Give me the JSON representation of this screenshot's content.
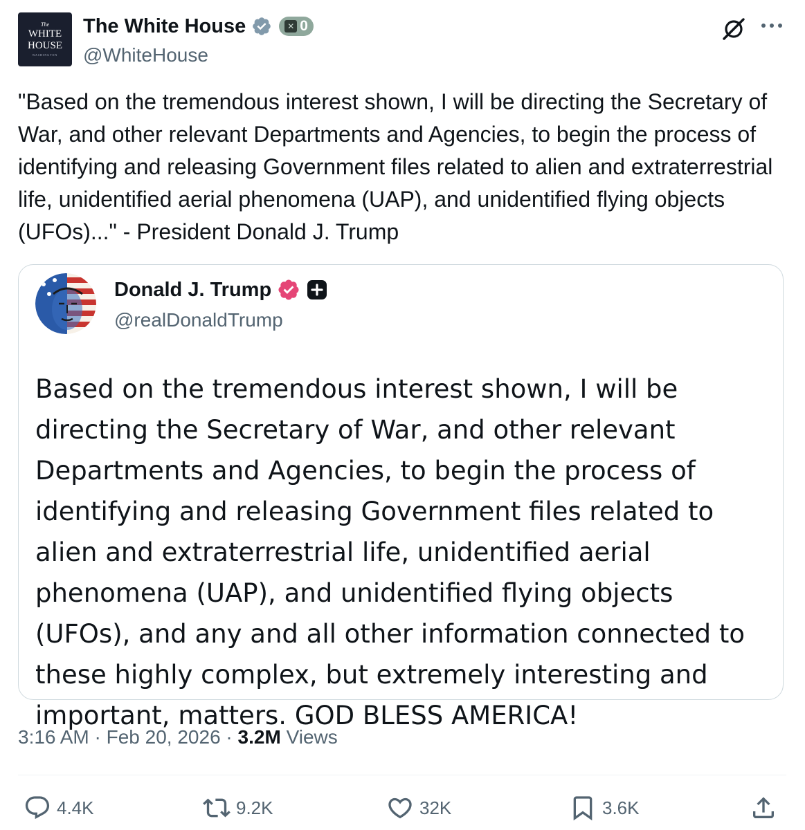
{
  "post": {
    "author": {
      "display_name": "The White House",
      "handle": "@WhiteHouse",
      "avatar_text": {
        "line0": "The",
        "line1": "WHITE",
        "line2": "HOUSE",
        "line3": "WASHINGTON"
      },
      "badge_count": "0"
    },
    "text": "\"Based on the tremendous interest shown, I will be directing the Secretary of War, and other relevant Departments and Agencies, to begin the process of identifying and releasing Government files related to alien and extraterrestrial life, unidentified aerial phenomena (UAP), and unidentified flying objects (UFOs)...\" - President Donald J. Trump",
    "quote": {
      "display_name": "Donald J. Trump",
      "handle": "@realDonaldTrump",
      "text": "Based on the tremendous interest shown, I will be directing the Secretary of War, and other relevant Departments and Agencies, to begin the process of identifying and releasing Government files related to alien and extraterrestrial life, unidentified aerial phenomena (UAP), and unidentified flying objects (UFOs), and any and all other information connected to these highly complex, but extremely interesting and important, matters. GOD BLESS AMERICA!"
    },
    "meta": {
      "time": "3:16 AM",
      "separator": " · ",
      "date": "Feb 20, 2026",
      "views_count": "3.2M",
      "views_label": " Views"
    },
    "actions": {
      "replies": "4.4K",
      "reposts": "9.2K",
      "likes": "32K",
      "bookmarks": "3.6K"
    },
    "icons": [
      "verified-gray-icon",
      "x-badge-icon",
      "grok-icon",
      "more-icon",
      "verified-pink-icon",
      "plus-badge-icon",
      "reply-icon",
      "retweet-icon",
      "like-icon",
      "bookmark-icon",
      "share-icon"
    ],
    "colors": {
      "text": "#0f1419",
      "secondary": "#536471",
      "border": "#cfd9de",
      "wh_avatar_bg": "#1a1f2e",
      "verified_gray": "#829aab",
      "verified_pink": "#e0245e"
    }
  }
}
